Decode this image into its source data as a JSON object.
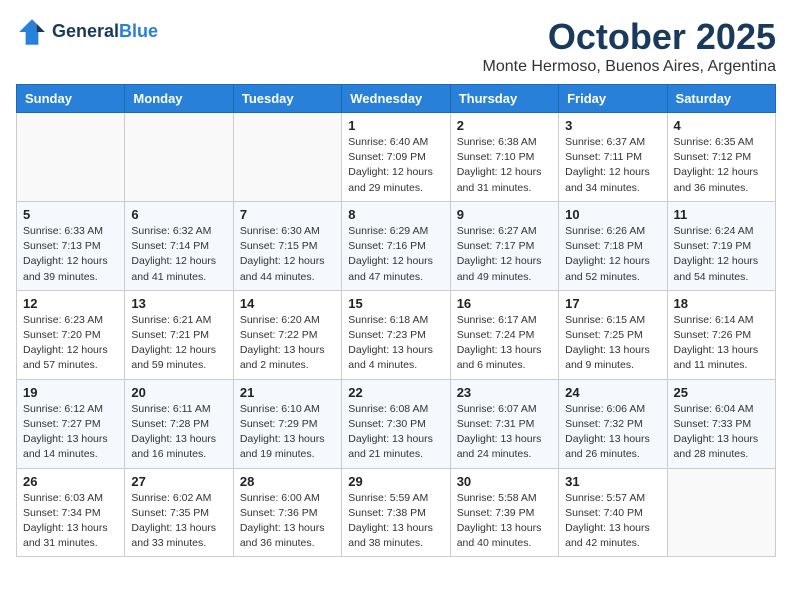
{
  "header": {
    "logo_line1": "General",
    "logo_line2": "Blue",
    "month": "October 2025",
    "location": "Monte Hermoso, Buenos Aires, Argentina"
  },
  "weekdays": [
    "Sunday",
    "Monday",
    "Tuesday",
    "Wednesday",
    "Thursday",
    "Friday",
    "Saturday"
  ],
  "weeks": [
    [
      {
        "day": "",
        "info": ""
      },
      {
        "day": "",
        "info": ""
      },
      {
        "day": "",
        "info": ""
      },
      {
        "day": "1",
        "info": "Sunrise: 6:40 AM\nSunset: 7:09 PM\nDaylight: 12 hours\nand 29 minutes."
      },
      {
        "day": "2",
        "info": "Sunrise: 6:38 AM\nSunset: 7:10 PM\nDaylight: 12 hours\nand 31 minutes."
      },
      {
        "day": "3",
        "info": "Sunrise: 6:37 AM\nSunset: 7:11 PM\nDaylight: 12 hours\nand 34 minutes."
      },
      {
        "day": "4",
        "info": "Sunrise: 6:35 AM\nSunset: 7:12 PM\nDaylight: 12 hours\nand 36 minutes."
      }
    ],
    [
      {
        "day": "5",
        "info": "Sunrise: 6:33 AM\nSunset: 7:13 PM\nDaylight: 12 hours\nand 39 minutes."
      },
      {
        "day": "6",
        "info": "Sunrise: 6:32 AM\nSunset: 7:14 PM\nDaylight: 12 hours\nand 41 minutes."
      },
      {
        "day": "7",
        "info": "Sunrise: 6:30 AM\nSunset: 7:15 PM\nDaylight: 12 hours\nand 44 minutes."
      },
      {
        "day": "8",
        "info": "Sunrise: 6:29 AM\nSunset: 7:16 PM\nDaylight: 12 hours\nand 47 minutes."
      },
      {
        "day": "9",
        "info": "Sunrise: 6:27 AM\nSunset: 7:17 PM\nDaylight: 12 hours\nand 49 minutes."
      },
      {
        "day": "10",
        "info": "Sunrise: 6:26 AM\nSunset: 7:18 PM\nDaylight: 12 hours\nand 52 minutes."
      },
      {
        "day": "11",
        "info": "Sunrise: 6:24 AM\nSunset: 7:19 PM\nDaylight: 12 hours\nand 54 minutes."
      }
    ],
    [
      {
        "day": "12",
        "info": "Sunrise: 6:23 AM\nSunset: 7:20 PM\nDaylight: 12 hours\nand 57 minutes."
      },
      {
        "day": "13",
        "info": "Sunrise: 6:21 AM\nSunset: 7:21 PM\nDaylight: 12 hours\nand 59 minutes."
      },
      {
        "day": "14",
        "info": "Sunrise: 6:20 AM\nSunset: 7:22 PM\nDaylight: 13 hours\nand 2 minutes."
      },
      {
        "day": "15",
        "info": "Sunrise: 6:18 AM\nSunset: 7:23 PM\nDaylight: 13 hours\nand 4 minutes."
      },
      {
        "day": "16",
        "info": "Sunrise: 6:17 AM\nSunset: 7:24 PM\nDaylight: 13 hours\nand 6 minutes."
      },
      {
        "day": "17",
        "info": "Sunrise: 6:15 AM\nSunset: 7:25 PM\nDaylight: 13 hours\nand 9 minutes."
      },
      {
        "day": "18",
        "info": "Sunrise: 6:14 AM\nSunset: 7:26 PM\nDaylight: 13 hours\nand 11 minutes."
      }
    ],
    [
      {
        "day": "19",
        "info": "Sunrise: 6:12 AM\nSunset: 7:27 PM\nDaylight: 13 hours\nand 14 minutes."
      },
      {
        "day": "20",
        "info": "Sunrise: 6:11 AM\nSunset: 7:28 PM\nDaylight: 13 hours\nand 16 minutes."
      },
      {
        "day": "21",
        "info": "Sunrise: 6:10 AM\nSunset: 7:29 PM\nDaylight: 13 hours\nand 19 minutes."
      },
      {
        "day": "22",
        "info": "Sunrise: 6:08 AM\nSunset: 7:30 PM\nDaylight: 13 hours\nand 21 minutes."
      },
      {
        "day": "23",
        "info": "Sunrise: 6:07 AM\nSunset: 7:31 PM\nDaylight: 13 hours\nand 24 minutes."
      },
      {
        "day": "24",
        "info": "Sunrise: 6:06 AM\nSunset: 7:32 PM\nDaylight: 13 hours\nand 26 minutes."
      },
      {
        "day": "25",
        "info": "Sunrise: 6:04 AM\nSunset: 7:33 PM\nDaylight: 13 hours\nand 28 minutes."
      }
    ],
    [
      {
        "day": "26",
        "info": "Sunrise: 6:03 AM\nSunset: 7:34 PM\nDaylight: 13 hours\nand 31 minutes."
      },
      {
        "day": "27",
        "info": "Sunrise: 6:02 AM\nSunset: 7:35 PM\nDaylight: 13 hours\nand 33 minutes."
      },
      {
        "day": "28",
        "info": "Sunrise: 6:00 AM\nSunset: 7:36 PM\nDaylight: 13 hours\nand 36 minutes."
      },
      {
        "day": "29",
        "info": "Sunrise: 5:59 AM\nSunset: 7:38 PM\nDaylight: 13 hours\nand 38 minutes."
      },
      {
        "day": "30",
        "info": "Sunrise: 5:58 AM\nSunset: 7:39 PM\nDaylight: 13 hours\nand 40 minutes."
      },
      {
        "day": "31",
        "info": "Sunrise: 5:57 AM\nSunset: 7:40 PM\nDaylight: 13 hours\nand 42 minutes."
      },
      {
        "day": "",
        "info": ""
      }
    ]
  ]
}
